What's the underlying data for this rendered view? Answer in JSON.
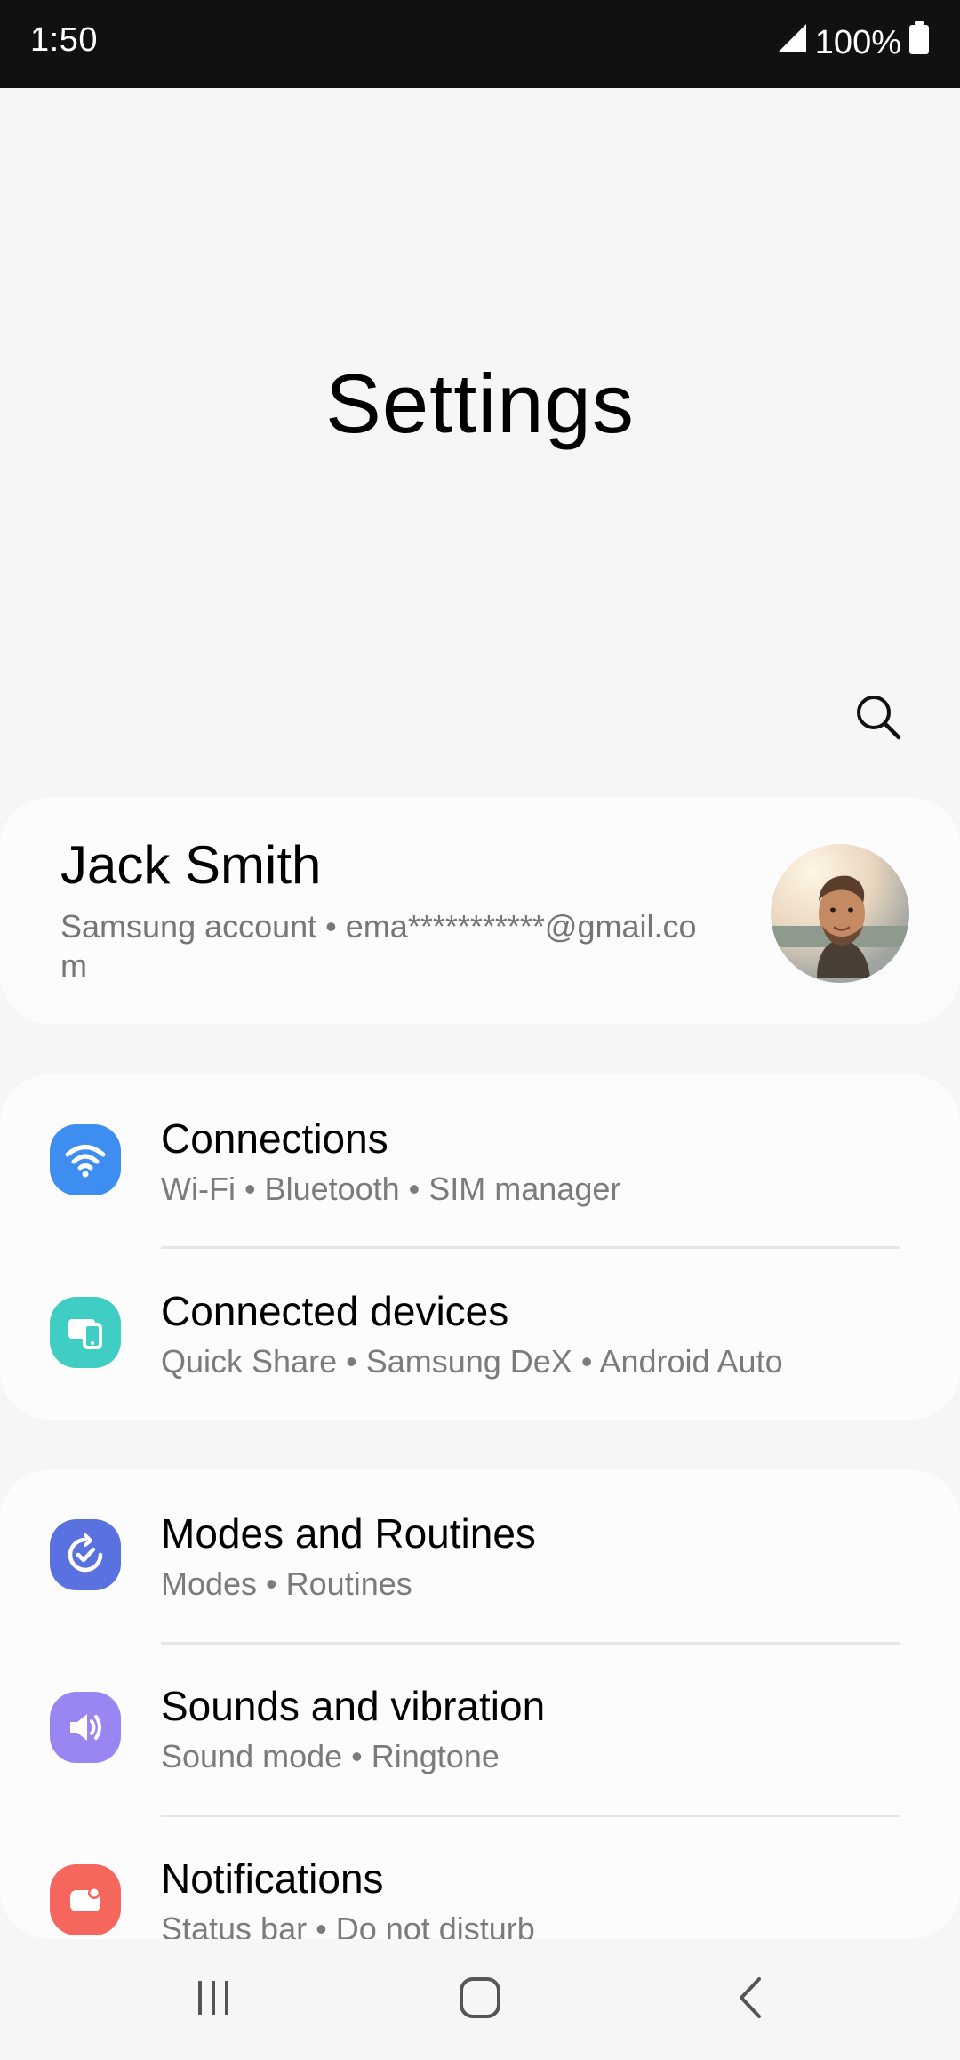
{
  "status_bar": {
    "time": "1:50",
    "battery": "100%",
    "icons": [
      "signal-icon",
      "battery-icon"
    ]
  },
  "header": {
    "title": "Settings",
    "search_icon": "search-icon"
  },
  "account": {
    "name": "Jack Smith",
    "subtitle": "Samsung account  •  ema***********@gmail.com"
  },
  "groups": [
    {
      "items": [
        {
          "icon": "wifi-icon",
          "color": "#3e8df0",
          "title": "Connections",
          "subtitle": "Wi-Fi  •  Bluetooth  •  SIM manager"
        },
        {
          "icon": "connected-devices-icon",
          "color": "#3fcdc4",
          "title": "Connected devices",
          "subtitle": "Quick Share  •  Samsung DeX  •  Android Auto"
        }
      ]
    },
    {
      "items": [
        {
          "icon": "modes-routines-icon",
          "color": "#5a71e0",
          "title": "Modes and Routines",
          "subtitle": "Modes  •  Routines"
        },
        {
          "icon": "volume-icon",
          "color": "#9a86f2",
          "title": "Sounds and vibration",
          "subtitle": "Sound mode  •  Ringtone"
        },
        {
          "icon": "notifications-icon",
          "color": "#f5675d",
          "title": "Notifications",
          "subtitle": "Status bar  •  Do not disturb"
        }
      ]
    }
  ],
  "nav_bar": {
    "buttons": [
      "recents-icon",
      "home-icon",
      "back-icon"
    ]
  }
}
